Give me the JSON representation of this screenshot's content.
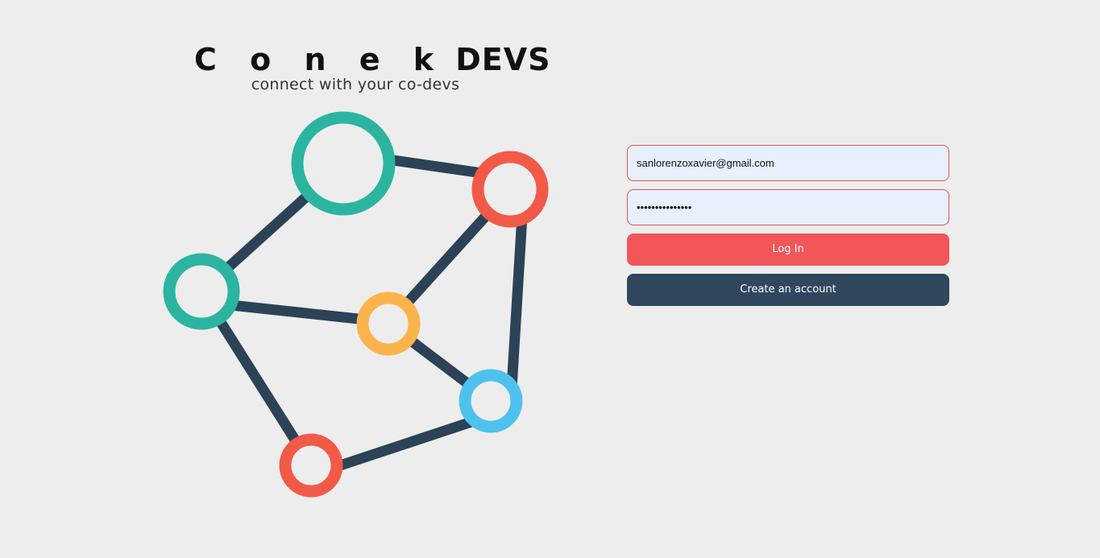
{
  "brand": {
    "title_spaced": "C o n e k",
    "title_bold": "DEVS",
    "tagline": "connect with your co-devs"
  },
  "login": {
    "email_value": "sanlorenzoxavier@gmail.com",
    "password_value": "passwordpasswor",
    "login_label": "Log In",
    "create_label": "Create an account"
  },
  "colors": {
    "background": "#ededed",
    "teal": "#2bb5a0",
    "red": "#f25a48",
    "yellow": "#fbb44c",
    "blue": "#4fc1ef",
    "navy": "#2c4257",
    "login_button": "#f25658",
    "create_button": "#30475e"
  }
}
